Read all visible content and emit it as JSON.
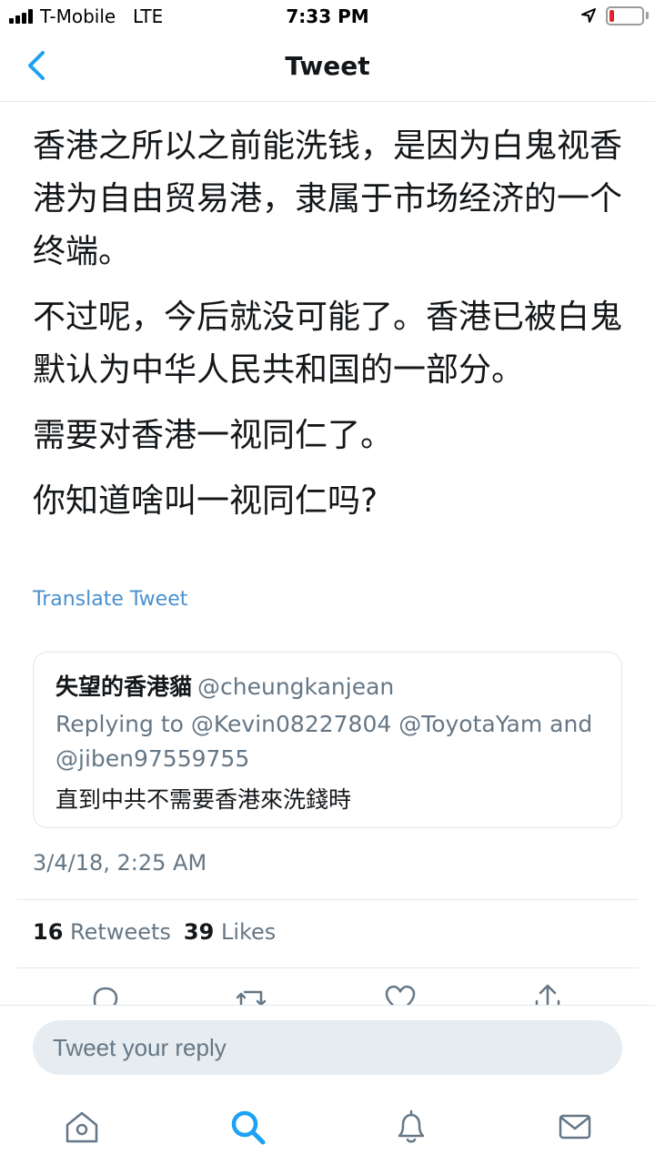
{
  "status_bar": {
    "carrier": "T-Mobile",
    "network": "LTE",
    "time": "7:33 PM",
    "battery_level": 0.15,
    "battery_color": "#e0242c"
  },
  "nav": {
    "back_icon": "chevron-left-icon",
    "title": "Tweet"
  },
  "tweet": {
    "paragraphs": [
      "香港之所以之前能洗钱，是因为白鬼视香港为自由贸易港，隶属于市场经济的一个终端。",
      "不过呢，今后就没可能了。香港已被白鬼默认为中华人民共和国的一部分。",
      "需要对香港一视同仁了。",
      "你知道啥叫一视同仁吗?"
    ],
    "translate_label": "Translate Tweet",
    "quoted": {
      "name": "失望的香港貓",
      "handle": "@cheungkanjean",
      "replying_to": "Replying to @Kevin08227804 @ToyotaYam and @jiben97559755",
      "text": "直到中共不需要香港來洗錢時"
    },
    "timestamp": "3/4/18, 2:25 AM",
    "stats": {
      "retweets_count": "16",
      "retweets_label": "Retweets",
      "likes_count": "39",
      "likes_label": "Likes"
    }
  },
  "actions": [
    "reply-icon",
    "retweet-icon",
    "like-icon",
    "share-icon"
  ],
  "reply": {
    "placeholder": "Tweet your reply"
  },
  "tab_bar": {
    "tabs": [
      "home-icon",
      "search-icon",
      "notifications-icon",
      "messages-icon"
    ],
    "active": "search-icon"
  },
  "colors": {
    "accent": "#1da1f2",
    "link": "#4a90cf",
    "text": "#14171a",
    "secondary": "#657786"
  }
}
